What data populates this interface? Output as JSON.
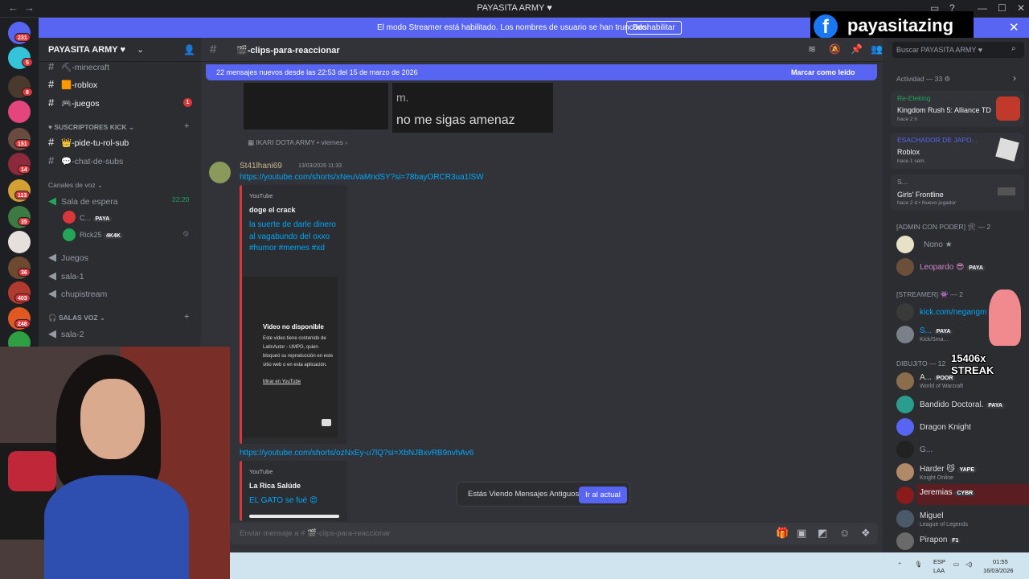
{
  "window": {
    "title": "PAYASITA ARMY ♥",
    "nav_back": "←",
    "nav_fwd": "→"
  },
  "banner": {
    "text": "El modo Streamer está habilitado. Los nombres de usuario se han truncado.",
    "button": "Deshabilitar",
    "close": "✕"
  },
  "overlay": {
    "facebook_name": "payasitazing",
    "streak": "15406x STREAK"
  },
  "servers": {
    "badges": [
      "231",
      "5",
      "8",
      "151",
      "14",
      "113",
      "35",
      "36",
      "403",
      "248"
    ]
  },
  "guild": {
    "name": "PAYASITA ARMY ♥"
  },
  "channels": [
    {
      "name": "⛏-minecraft"
    },
    {
      "name": "🟧-roblox"
    },
    {
      "name": "🎮-juegos",
      "badge": "1"
    }
  ],
  "cat_subs": {
    "title": "SUSCRIPTORES KICK",
    "channels": [
      "👑-pide-tu-rol-sub",
      "💬-chat-de-subs"
    ]
  },
  "voice": {
    "category": "Canales de voz",
    "waiting": "Sala de espera",
    "timer": "22:20",
    "users": [
      {
        "name": "C...",
        "tag": "PAYA"
      },
      {
        "name": "Rick25",
        "tag": "4K4K"
      }
    ],
    "channels": [
      "Juegos",
      "sala-1",
      "chupistream"
    ]
  },
  "cat_salas": {
    "title": "SALAS VOZ",
    "channels": [
      "sala-2"
    ]
  },
  "header": {
    "channel": "🎬-clips-para-reaccionar"
  },
  "newbar": {
    "text": "22 mensajes nuevos desde las 22:53 del 15 de marzo de 2026",
    "action": "Marcar como leído"
  },
  "old_message": {
    "img_line1": "m.",
    "img_line2": "no me sigas amenaz",
    "reply_name": "IKARI DOTA ARMY",
    "reply_time": "viernes"
  },
  "message": {
    "author": "St41lhani69",
    "timestamp": "13/03/2026 11:33",
    "link1": "https://youtube.com/shorts/xNeuVaMndSY?si=78bayORCR3ua1lSW",
    "embed1": {
      "provider": "YouTube",
      "title": "doge el crack",
      "desc": "la suerte de darle dinero al vagabundo del oxxo #humor #memes #xd"
    },
    "video": {
      "title": "Video no disponible",
      "text": "Este video tiene contenido de LatinAutor - UMPG, quien bloqueó su reproducción en este sitio web o en esta aplicación.",
      "link": "Mirar en YouTube"
    },
    "link2": "https://youtube.com/shorts/ozNxEy-u7lQ?si=XbNJBxvRB9nvhAv6",
    "embed2": {
      "provider": "YouTube",
      "title": "La Rica Salúde",
      "desc": "EL GATO se fué 😍"
    }
  },
  "old_toast": {
    "text": "Estás Viendo Mensajes Antiguos",
    "button": "Ir al actual"
  },
  "composer": {
    "placeholder": "Enviar mensaje a # 🎬-clips-para-reaccionar"
  },
  "search": {
    "placeholder": "Buscar PAYASITA ARMY ♥"
  },
  "activity": {
    "title": "Actividad — 33",
    "cards": [
      {
        "user": "Re-Eleking",
        "game": "Kingdom Rush 5: Alliance TD",
        "sub": "hace 2 h"
      },
      {
        "user": "ESACHADOR DE JAPO...",
        "game": "Roblox",
        "sub": "hace 1 sem."
      },
      {
        "user": "S...",
        "game": "Girls' Frontline",
        "sub": "hace 2 d  •  Nuevo jugador"
      }
    ]
  },
  "members": {
    "groups": [
      {
        "title": "[ADMIN CON PODER] 🛠 — 2",
        "members": [
          {
            "name": "Nono ★"
          },
          {
            "name": "Leopardo 😎",
            "tag": "PAYA"
          }
        ]
      },
      {
        "title": "[STREAMER] 👾 — 2",
        "members": [
          {
            "name": "kick.com/negangm"
          },
          {
            "name": "S...",
            "tag": "PAYA",
            "sub": "Kick/Sma..."
          }
        ]
      },
      {
        "title": "DIBUJITO — 12",
        "members": [
          {
            "name": "A...",
            "tag": "POOR",
            "sub": "World of Warcraft"
          },
          {
            "name": "Bandido Doctoral.",
            "tag": "PAYA"
          },
          {
            "name": "Dragon Knight"
          },
          {
            "name": "G..."
          },
          {
            "name": "Harder 😼",
            "tag": "YAPE",
            "sub": "Knight Online"
          },
          {
            "name": "Jeremias",
            "tag": "CYBR"
          },
          {
            "name": "Miguel",
            "sub": "League of Legends"
          },
          {
            "name": "Pirapon",
            "tag": "F1"
          }
        ]
      }
    ]
  },
  "taskbar": {
    "lang1": "ESP",
    "lang2": "LAA",
    "time": "01:55",
    "date": "16/03/2026"
  },
  "colors": {
    "accent": "#5865f2",
    "link": "#00a8fc",
    "danger": "#da373c"
  }
}
